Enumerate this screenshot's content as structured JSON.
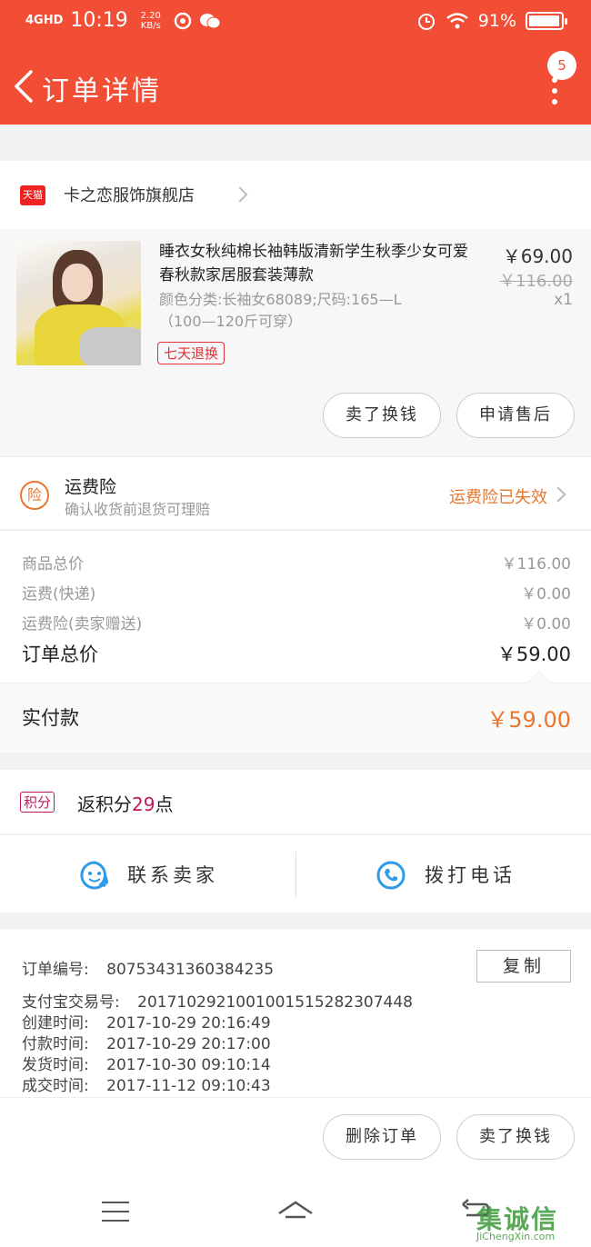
{
  "status_bar": {
    "network": "4GHD",
    "time": "10:19",
    "speed": "2.20 KB/s",
    "battery": "91%"
  },
  "nav": {
    "title": "订单详情",
    "badge_count": "5"
  },
  "shop": {
    "platform_badge": "天猫",
    "name": "卡之恋服饰旗舰店"
  },
  "goods": {
    "title": "睡衣女秋纯棉长袖韩版清新学生秋季少女可爱春秋款家居服套装薄款",
    "sku": "颜色分类:长袖女68089;尺码:165—L（100—120斤可穿）",
    "tag": "七天退换",
    "price": "￥69.00",
    "original_price": "￥116.00",
    "quantity": "x1",
    "btn_resell": "卖了换钱",
    "btn_aftersale": "申请售后"
  },
  "insurance": {
    "icon_text": "险",
    "title": "运费险",
    "subtitle": "确认收货前退货可理赔",
    "status": "运费险已失效"
  },
  "fees": {
    "rows": [
      {
        "label": "商品总价",
        "value": "￥116.00"
      },
      {
        "label": "运费(快递)",
        "value": "￥0.00"
      },
      {
        "label": "运费险(卖家赠送)",
        "value": "￥0.00"
      }
    ],
    "total_label": "订单总价",
    "total_value": "￥59.00",
    "paid_label": "实付款",
    "paid_value": "￥59.00"
  },
  "points": {
    "badge": "积分",
    "prefix": "返积分",
    "value": "29",
    "suffix": "点"
  },
  "contact": {
    "seller_label": "联系卖家",
    "phone_label": "拨打电话"
  },
  "order_info": {
    "order_no_label": "订单编号:",
    "order_no": "80753431360384235",
    "copy_label": "复制",
    "rows": [
      {
        "label": "支付宝交易号:",
        "value": "2017102921001001515282307448"
      },
      {
        "label": "创建时间:",
        "value": "2017-10-29 20:16:49"
      },
      {
        "label": "付款时间:",
        "value": "2017-10-29 20:17:00"
      },
      {
        "label": "发货时间:",
        "value": "2017-10-30 09:10:14"
      },
      {
        "label": "成交时间:",
        "value": "2017-11-12 09:10:43"
      }
    ]
  },
  "actions": {
    "delete_label": "删除订单",
    "resell_label": "卖了换钱"
  },
  "watermark": {
    "text": "集诚信",
    "url": "JiChengXin.com"
  },
  "colors": {
    "header": "#f24e36",
    "accent_orange": "#e8772e",
    "points_pink": "#c2185b",
    "contact_blue": "#2e9be8"
  }
}
